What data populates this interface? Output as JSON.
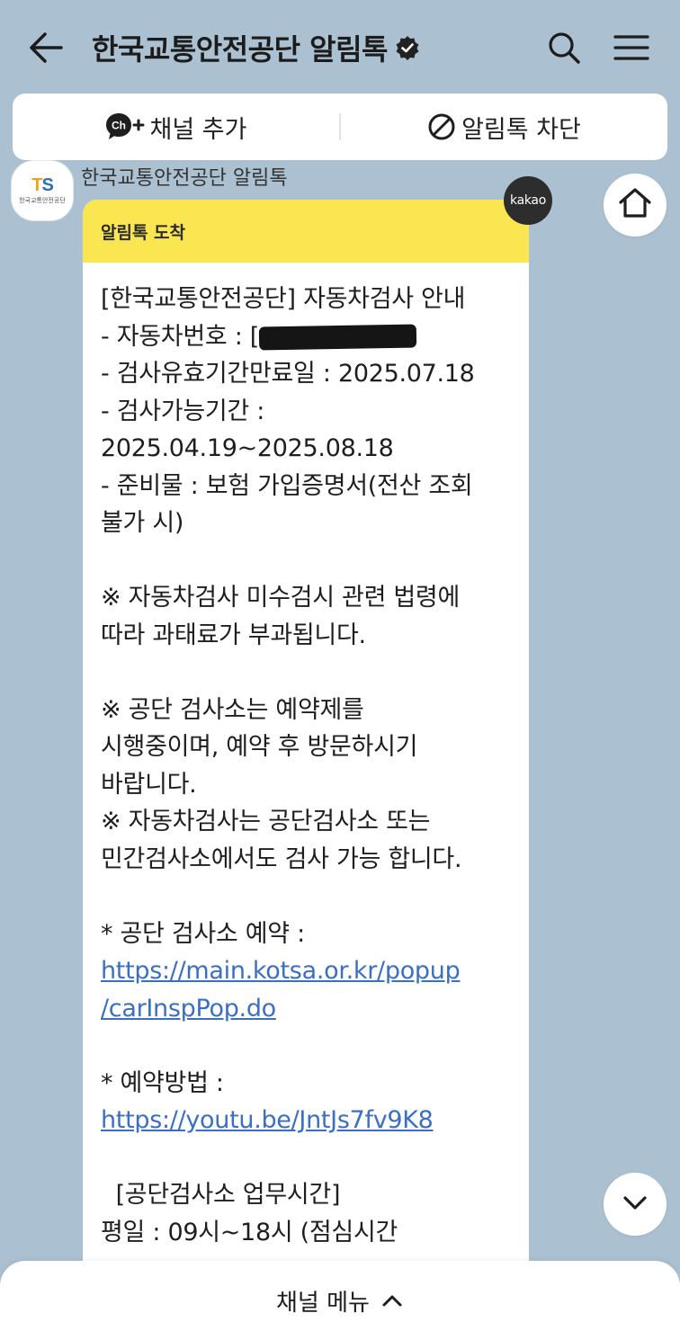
{
  "header": {
    "title": "한국교통안전공단 알림톡",
    "icons": [
      "back-arrow-icon",
      "verified-badge-icon",
      "search-icon",
      "hamburger-menu-icon"
    ]
  },
  "actions": {
    "add_channel_label": "채널 추가",
    "add_channel_icon_text": "Ch+",
    "block_label": "알림톡 차단"
  },
  "channel": {
    "avatar_logo": "TS",
    "avatar_subtitle": "한국교통안전공단",
    "sender_name": "한국교통안전공단 알림톡"
  },
  "message": {
    "header": "알림톡 도착",
    "badge": "kakao",
    "lines": [
      "[한국교통안전공단] 자동차검사 안내",
      "- 자동차번호 : [",
      "- 검사유효기간만료일 : 2025.07.18",
      "- 검사가능기간 :",
      "2025.04.19~2025.08.18",
      "- 준비물 : 보험 가입증명서(전산 조회",
      "불가 시)",
      "",
      "※ 자동차검사 미수검시 관련 법령에",
      "따라 과태료가 부과됩니다.",
      "",
      "※ 공단 검사소는 예약제를",
      "시행중이며, 예약 후 방문하시기",
      "바랍니다.",
      "※ 자동차검사는 공단검사소 또는",
      "민간검사소에서도 검사 가능 합니다.",
      "",
      "* 공단 검사소 예약 :",
      "https://main.kotsa.or.kr/popup",
      "/carInspPop.do",
      "",
      "* 예약방법 :",
      "https://youtu.be/JntJs7fv9K8",
      "",
      "  [공단검사소 업무시간]",
      "평일 : 09시~18시 (점심시간"
    ]
  },
  "bottom": {
    "label": "채널 메뉴"
  },
  "colors": {
    "background": "#abc1d1",
    "bubble_header": "#fae650",
    "link": "#3b6fc4"
  }
}
